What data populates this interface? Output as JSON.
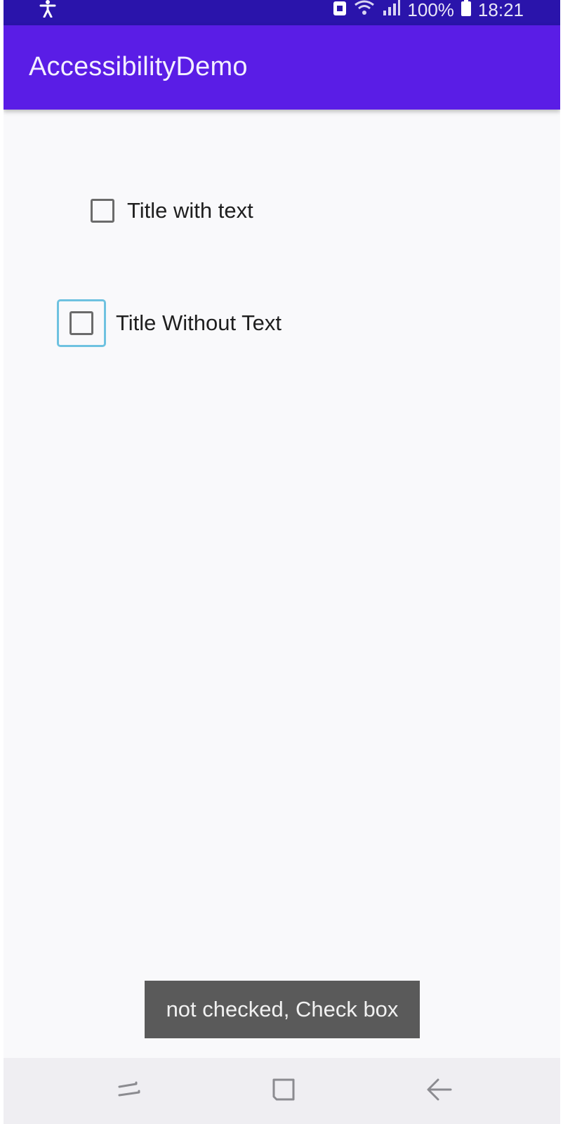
{
  "status_bar": {
    "left_icon": "accessibility-icon",
    "battery_text": "100%",
    "time": "18:21",
    "icons": [
      "nfc-icon",
      "wifi-icon",
      "signal-icon",
      "battery-icon"
    ]
  },
  "app_bar": {
    "title": "AccessibilityDemo",
    "color": "#5a1de6"
  },
  "checkboxes": [
    {
      "label": "Title with text",
      "checked": false
    },
    {
      "label": "Title Without Text",
      "checked": false,
      "focused": true
    }
  ],
  "toast": {
    "text": "not checked, Check box"
  },
  "nav_bar": {
    "buttons": [
      "recent-apps-icon",
      "home-icon",
      "back-icon"
    ]
  },
  "colors": {
    "status_bar": "#2a14ab",
    "accent": "#5a1de6",
    "focus": "#6ec2e0"
  }
}
